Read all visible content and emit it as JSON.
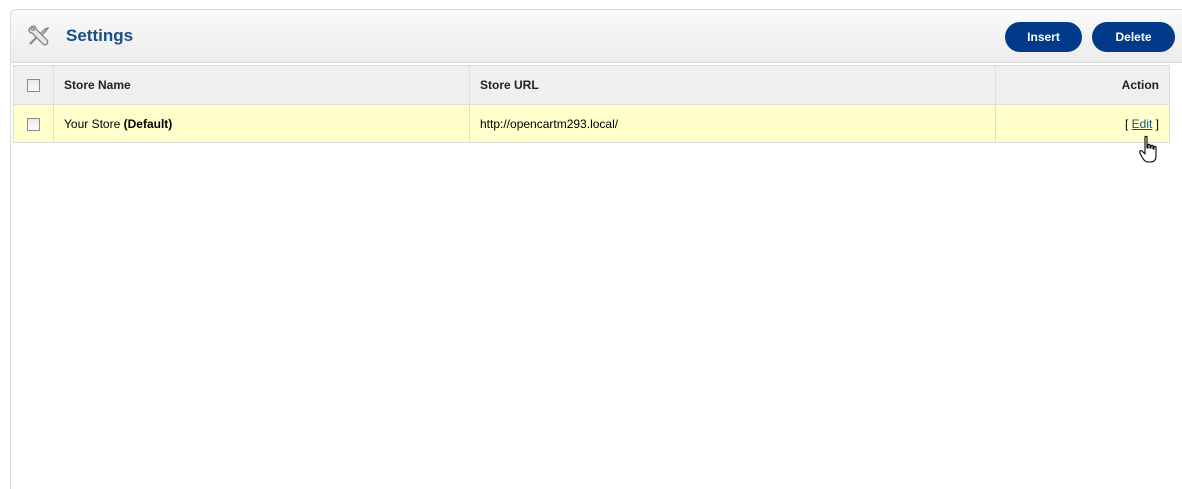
{
  "heading": {
    "title": "Settings",
    "icon": "wrench-screwdriver-icon"
  },
  "buttons": {
    "insert": "Insert",
    "delete": "Delete"
  },
  "table": {
    "headers": {
      "store_name": "Store Name",
      "store_url": "Store URL",
      "action": "Action"
    },
    "rows": [
      {
        "name": "Your Store",
        "name_suffix": "(Default)",
        "url": "http://opencartm293.local/",
        "action_open": "[ ",
        "action_label": "Edit",
        "action_close": " ]"
      }
    ]
  },
  "colors": {
    "title": "#1a4f84",
    "button_bg": "#003a88",
    "row_highlight": "#ffffcb",
    "header_bg": "#efefef"
  }
}
